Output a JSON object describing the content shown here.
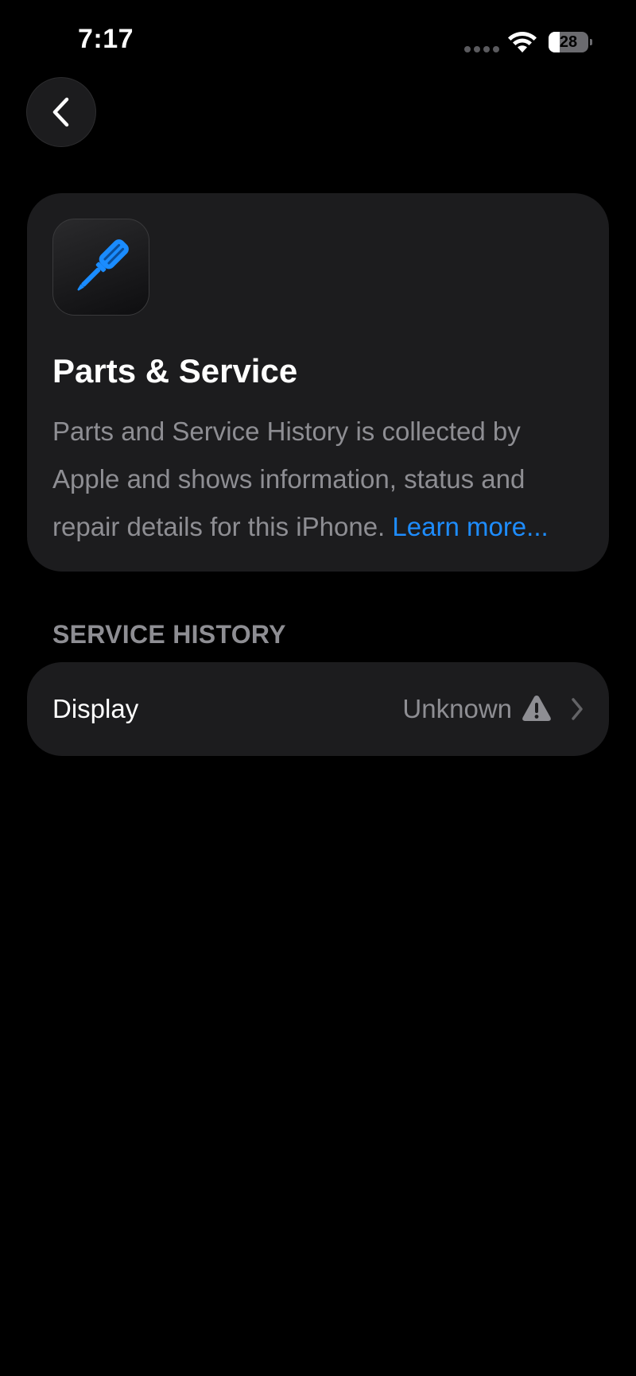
{
  "status_bar": {
    "time": "7:17",
    "battery_level": "28",
    "battery_fraction": 0.28
  },
  "nav": {
    "back_icon": "chevron-left-icon"
  },
  "info_card": {
    "icon": "screwdriver-icon",
    "title": "Parts & Service",
    "description": "Parts and Service History is collected by Apple and shows information, status and repair details for this iPhone.",
    "link_label": "Learn more..."
  },
  "service_history": {
    "header": "SERVICE HISTORY",
    "items": [
      {
        "label": "Display",
        "value": "Unknown",
        "status_icon": "warning-triangle-icon"
      }
    ]
  },
  "colors": {
    "background": "#000000",
    "card": "#1c1c1e",
    "accent": "#1e8dff",
    "secondary_text": "#8e8e93",
    "icon_blue": "#1a8cff"
  }
}
